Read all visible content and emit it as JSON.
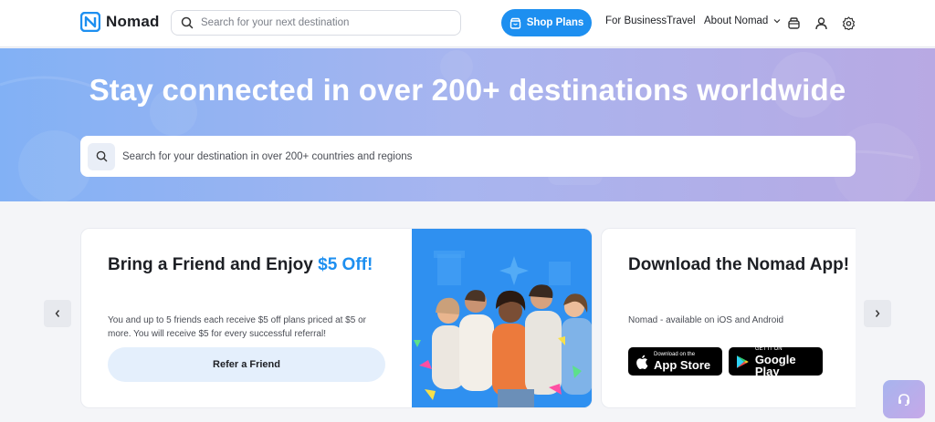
{
  "nav": {
    "logo_text": "Nomad",
    "search_placeholder": "Search for your next destination",
    "shop_plans_label": "Shop Plans",
    "links": [
      "For Business",
      "Travel",
      "About Nomad"
    ]
  },
  "hero": {
    "title": "Stay connected in over 200+ destinations worldwide",
    "search_placeholder": "Search for your destination in over 200+ countries and regions"
  },
  "cards": {
    "referral": {
      "title_main": "Bring a Friend and Enjoy ",
      "title_accent": "$5 Off!",
      "description": "You and up to 5 friends each receive $5 off plans priced at $5 or more. You will receive $5 for every successful referral!",
      "button_label": "Refer a Friend"
    },
    "app": {
      "title": "Download the Nomad App!",
      "subtitle": "Nomad - available on iOS and Android",
      "app_store_small": "Download on the",
      "app_store_big": "App Store",
      "google_play_small": "GET IT ON",
      "google_play_big": "Google Play"
    }
  },
  "colors": {
    "brand_blue": "#1d8ff0",
    "hero_gradient_start": "#82b1f5",
    "hero_gradient_end": "#b8a9e3"
  },
  "icons": [
    "nomad-logo-icon",
    "search-icon",
    "shop-icon",
    "chevron-down-icon",
    "bag-icon",
    "user-icon",
    "settings-icon",
    "chevron-left-icon",
    "chevron-right-icon",
    "apple-icon",
    "google-play-icon",
    "headset-icon"
  ]
}
